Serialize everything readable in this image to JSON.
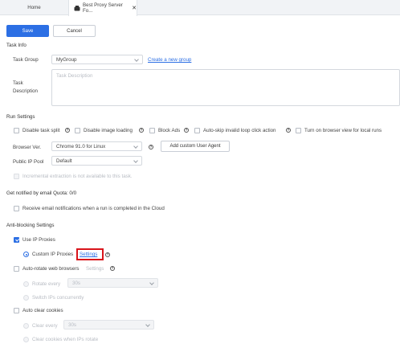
{
  "tabs": [
    {
      "label": "Home"
    },
    {
      "label": "Best Proxy Server Fo...",
      "close": "✕"
    }
  ],
  "toolbar": {
    "save_label": "Save",
    "cancel_label": "Cancel"
  },
  "task_info": {
    "heading": "Task Info",
    "group_label": "Task Group",
    "group_value": "MyGroup",
    "create_group_link": "Create a new group",
    "description_label_1": "Task",
    "description_label_2": "Description",
    "description_placeholder": "Task Description"
  },
  "run_settings": {
    "heading": "Run Settings",
    "options": [
      {
        "label": "Disable task split"
      },
      {
        "label": "Disable image loading"
      },
      {
        "label": "Block Ads"
      },
      {
        "label": "Auto-skip invalid loop click action"
      },
      {
        "label": "Turn on browser view for local runs"
      }
    ],
    "browser_label": "Browser Ver.",
    "browser_value": "Chrome 91.0 for Linux",
    "custom_ua_button": "Add custom User Agent",
    "ip_pool_label": "Public IP Pool",
    "ip_pool_value": "Default",
    "incremental_note": "Incremental extraction is not available to this task."
  },
  "email": {
    "heading": "Get notified by email Quota: 0/0",
    "option_label": "Receive email notifications when a run is completed in the Cloud"
  },
  "anti_blocking": {
    "heading": "Anti-blocking Settings",
    "use_ip_label": "Use IP Proxies",
    "custom_ip_label": "Custom IP Proxies",
    "settings_link": "Settings",
    "auto_rotate_label": "Auto-rotate web browsers",
    "auto_rotate_settings": "Settings",
    "rotate_every_label": "Rotate every",
    "rotate_every_value": "30s",
    "switch_ips_label": "Switch IPs concurrently",
    "auto_clear_label": "Auto clear cookies",
    "clear_every_label": "Clear every",
    "clear_every_value": "30s",
    "clear_when_ips_label": "Clear cookies when IPs rotate"
  },
  "colors": {
    "accent": "#2c6fe4",
    "highlight": "#d9141b"
  }
}
